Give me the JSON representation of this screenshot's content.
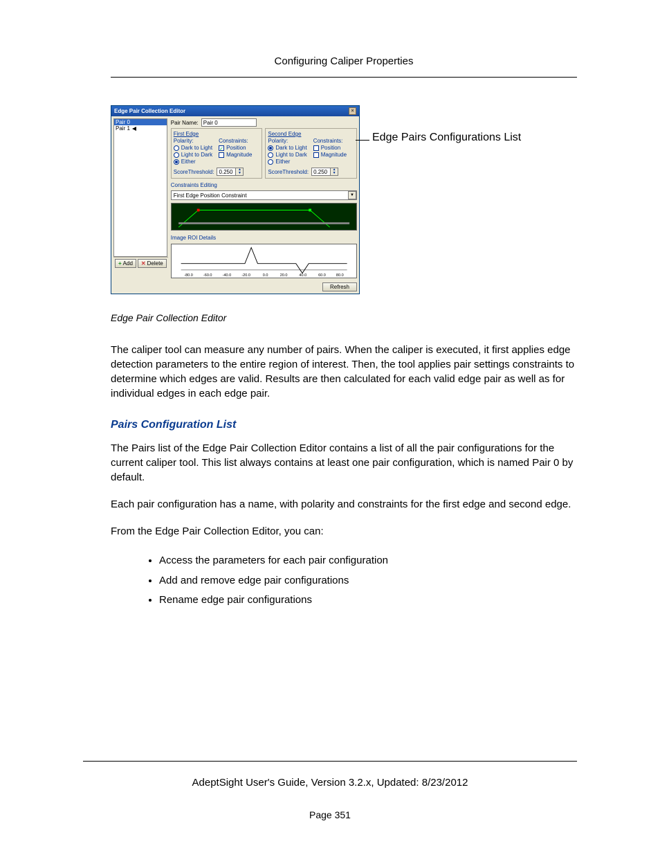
{
  "header_title": "Configuring Caliper Properties",
  "dialog_title": "Edge Pair Collection Editor",
  "pair_list": {
    "selected": "Pair 0",
    "other": "Pair 1"
  },
  "pair_name_label": "Pair Name:",
  "pair_name_value": "Pair 0",
  "first_edge": {
    "title": "First Edge",
    "polarity_label": "Polarity:",
    "opt_dark_to_light": "Dark to Light",
    "opt_light_to_dark": "Light to Dark",
    "opt_either": "Either",
    "constraints_label": "Constraints:",
    "opt_position": "Position",
    "opt_magnitude": "Magnitude",
    "score_label": "ScoreThreshold:",
    "score_value": "0.250"
  },
  "second_edge": {
    "title": "Second Edge",
    "polarity_label": "Polarity:",
    "opt_dark_to_light": "Dark to Light",
    "opt_light_to_dark": "Light to Dark",
    "opt_either": "Either",
    "constraints_label": "Constraints:",
    "opt_position": "Position",
    "opt_magnitude": "Magnitude",
    "score_label": "ScoreThreshold:",
    "score_value": "0.250"
  },
  "constraints_editing_label": "Constraints Editing",
  "dropdown_value": "First Edge Position Constraint",
  "roi_label": "Image ROI Details",
  "axis_ticks": [
    "-80.0",
    "-60.0",
    "-40.0",
    "-20.0",
    "0.0",
    "20.0",
    "40.0",
    "60.0",
    "80.0"
  ],
  "buttons": {
    "add": "Add",
    "delete": "Delete",
    "refresh": "Refresh"
  },
  "callout": "Edge Pairs Configurations List",
  "caption": "Edge Pair Collection Editor",
  "para1": "The caliper tool can measure any number of pairs. When the caliper is executed, it first applies edge detection parameters to the entire region of interest. Then, the tool applies pair settings constraints to determine which edges are valid. Results are then calculated for each valid edge pair as well as for individual edges in each edge pair.",
  "section_title": "Pairs Configuration List",
  "para2": "The Pairs list of the Edge Pair Collection Editor contains a list of all the pair configurations for the current caliper tool. This list always contains at least one pair configuration, which is named Pair 0 by default.",
  "para3": "Each pair configuration has a name, with polarity and constraints for the first edge and second edge.",
  "para4": "From the Edge Pair Collection Editor, you can:",
  "bullets": [
    "Access the parameters for each pair configuration",
    "Add and remove edge pair configurations",
    "Rename edge pair configurations"
  ],
  "footer_text": "AdeptSight User's Guide,  Version 3.2.x, Updated: 8/23/2012",
  "page_number": "Page 351"
}
